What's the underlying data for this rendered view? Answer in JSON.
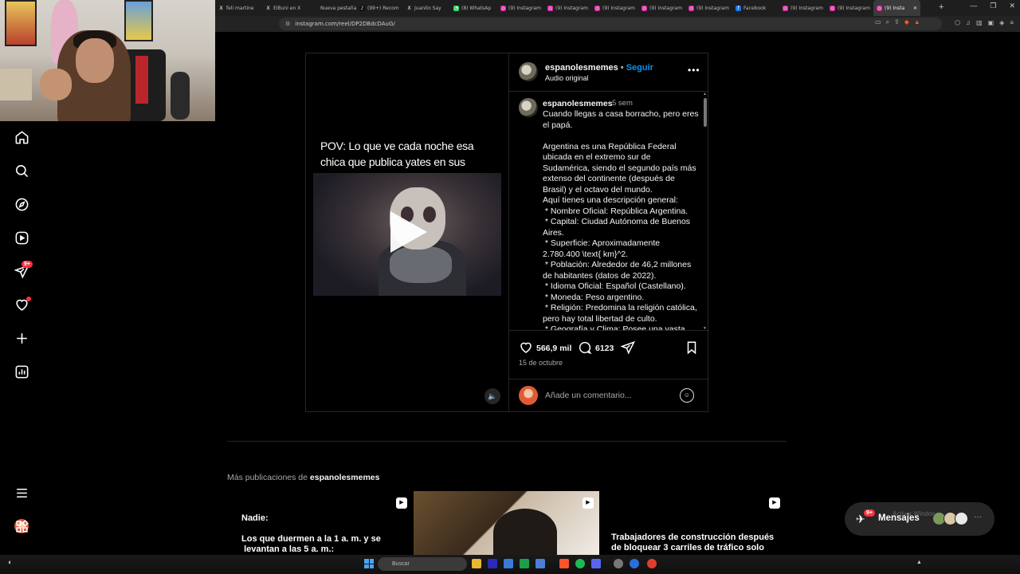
{
  "browser": {
    "tabs": [
      {
        "label": "feli martine",
        "icon": "x-icon"
      },
      {
        "label": "ElBuni en X",
        "icon": "x-icon"
      },
      {
        "label": "Nueva pestaña",
        "icon": ""
      },
      {
        "label": "(99+) Recom",
        "icon": "tiktok-icon"
      },
      {
        "label": "Juanito Say",
        "icon": "x-icon"
      },
      {
        "label": "(8) WhatsAp",
        "icon": "whatsapp-icon"
      },
      {
        "label": "(9) Instagram",
        "icon": "instagram-icon"
      },
      {
        "label": "(9) Instagram",
        "icon": "instagram-icon"
      },
      {
        "label": "(9) Instagram",
        "icon": "instagram-icon"
      },
      {
        "label": "(9) Instagram",
        "icon": "instagram-icon"
      },
      {
        "label": "(9) Instagram",
        "icon": "instagram-icon"
      },
      {
        "label": "Facebook",
        "icon": "facebook-icon"
      },
      {
        "label": "(9) Instagram",
        "icon": "instagram-icon"
      },
      {
        "label": "(9) Instagram",
        "icon": "instagram-icon"
      },
      {
        "label": "(9) Insta",
        "icon": "instagram-icon"
      }
    ],
    "url": "instagram.com/reel/DP2DBdcDAuG/"
  },
  "sidebar": {
    "icons": [
      "home-icon",
      "search-icon",
      "explore-icon",
      "reels-icon",
      "messages-icon",
      "notifications-icon",
      "create-icon",
      "dashboard-icon",
      "profile-avatar",
      "menu-icon",
      "threads-apps-icon"
    ],
    "messages_badge": "9+"
  },
  "post": {
    "video_title": "POV: Lo que ve cada noche esa chica que publica yates en sus historias",
    "username": "espanolesmemes",
    "separator": "•",
    "follow_label": "Seguir",
    "audio": "Audio original",
    "caption_user": "espanolesmemes",
    "caption_time": "5 sem",
    "caption_text": "Cuando llegas a casa borracho, pero eres el papá.\n\nArgentina es una República Federal ubicada en el extremo sur de Sudamérica, siendo el segundo país más extenso del continente (después de Brasil) y el octavo del mundo.\nAquí tienes una descripción general:\n * Nombre Oficial: República Argentina.\n * Capital: Ciudad Autónoma de Buenos Aires.\n * Superficie: Aproximadamente 2.780.400 \\text{ km}^2.\n * Población: Alrededor de 46,2 millones de habitantes (datos de 2022).\n * Idioma Oficial: Español (Castellano).\n * Moneda: Peso argentino.\n * Religión: Predomina la religión católica, pero hay total libertad de culto.\n * Geografía y Clima: Posee una vasta",
    "likes": "566,9 mil",
    "comments": "6123",
    "date": "15 de octubre",
    "comment_placeholder": "Añade un comentario..."
  },
  "more": {
    "prefix": "Más publicaciones de",
    "user": "espanolesmemes",
    "items": [
      {
        "text": "Nadie:\n\nLos que duermen a la 1 a. m. y se\n levantan a las 5 a. m.:"
      },
      {
        "text": ""
      },
      {
        "text": "Trabajadores de construcción después\nde bloquear 3 carriles de tráfico solo"
      }
    ]
  },
  "messages": {
    "label": "Mensajes",
    "badge": "9+",
    "watermark": "Activar Windows"
  },
  "taskbar": {
    "search_placeholder": "Buscar"
  }
}
